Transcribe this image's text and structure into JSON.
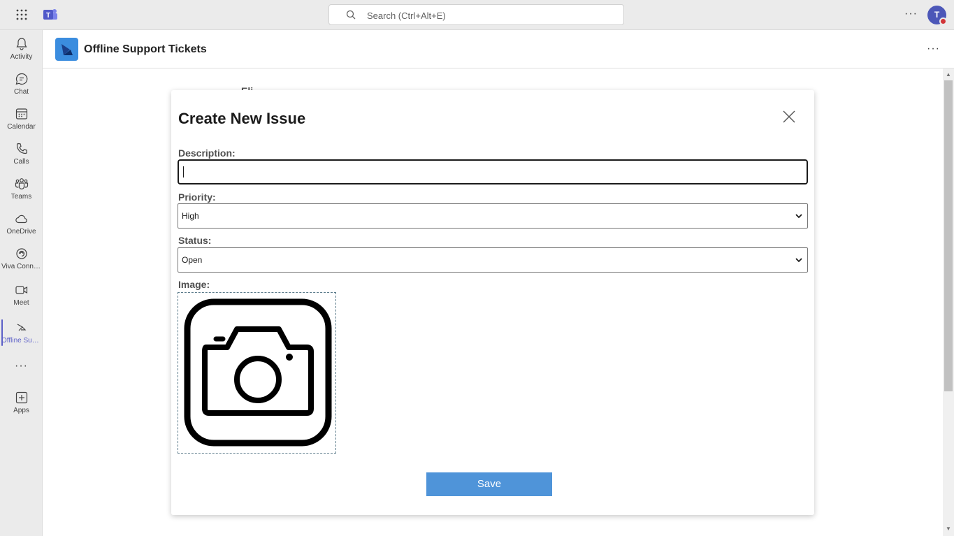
{
  "topbar": {
    "search_placeholder": "Search (Ctrl+Alt+E)",
    "more_label": "···",
    "avatar_initial": "T",
    "icons": [
      "waffle-icon",
      "teams-logo-icon",
      "search-icon",
      "more-icon"
    ]
  },
  "rail": {
    "items": [
      {
        "label": "Activity",
        "icon": "bell-icon"
      },
      {
        "label": "Chat",
        "icon": "chat-icon"
      },
      {
        "label": "Calendar",
        "icon": "calendar-icon"
      },
      {
        "label": "Calls",
        "icon": "phone-icon"
      },
      {
        "label": "Teams",
        "icon": "teams-icon"
      },
      {
        "label": "OneDrive",
        "icon": "cloud-icon"
      },
      {
        "label": "Viva Conne...",
        "icon": "viva-icon"
      },
      {
        "label": "Meet",
        "icon": "video-icon"
      },
      {
        "label": "Offline Sup...",
        "icon": "app-icon",
        "active": true
      },
      {
        "label": "Apps",
        "icon": "add-apps-icon"
      }
    ],
    "more_label": "···"
  },
  "app": {
    "title": "Offline Support Tickets",
    "more_label": "···",
    "background_text": "Eli"
  },
  "modal": {
    "title": "Create New Issue",
    "description_label": "Description:",
    "description_value": "",
    "priority_label": "Priority:",
    "priority_value": "High",
    "status_label": "Status:",
    "status_value": "Open",
    "image_label": "Image:",
    "image_icon": "camera-icon",
    "save_label": "Save"
  },
  "colors": {
    "accent": "#5b5fc7",
    "save_button": "#4f94d9",
    "app_icon": "#3b8ddf",
    "presence_busy": "#d13438"
  }
}
